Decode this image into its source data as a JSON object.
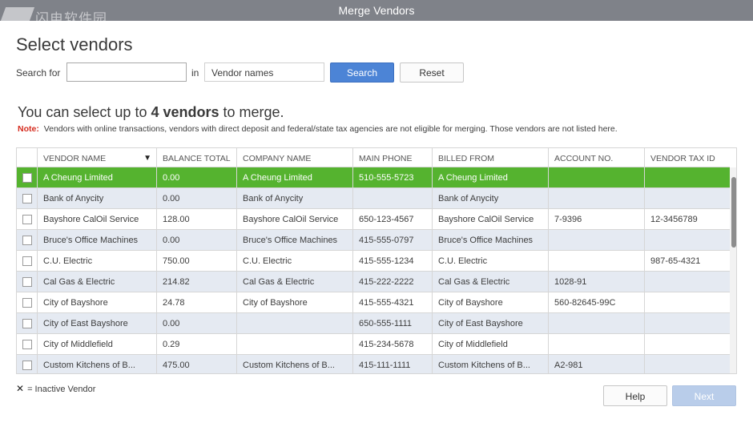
{
  "window": {
    "title": "Merge Vendors",
    "watermark": "闪电软件园"
  },
  "heading": "Select vendors",
  "search": {
    "label": "Search for",
    "value": "",
    "in_label": "in",
    "field_selected": "Vendor names",
    "search_button": "Search",
    "reset_button": "Reset"
  },
  "info": {
    "prefix": "You can select up to ",
    "count": "4 vendors",
    "suffix": " to merge."
  },
  "note": {
    "label": "Note:",
    "text": "Vendors with online transactions, vendors with direct deposit and federal/state tax agencies are not eligible for merging. Those vendors are not listed here."
  },
  "table": {
    "columns": [
      "VENDOR NAME",
      "BALANCE TOTAL",
      "COMPANY NAME",
      "MAIN PHONE",
      "BILLED FROM",
      "ACCOUNT NO.",
      "VENDOR TAX ID"
    ],
    "sort_icon": "sort-desc-icon",
    "rows": [
      [
        "A Cheung Limited",
        "0.00",
        "A Cheung Limited",
        "510-555-5723",
        "A Cheung Limited",
        "",
        ""
      ],
      [
        "Bank of Anycity",
        "0.00",
        "Bank of Anycity",
        "",
        "Bank of Anycity",
        "",
        ""
      ],
      [
        "Bayshore CalOil Service",
        "128.00",
        "Bayshore CalOil Service",
        "650-123-4567",
        "Bayshore CalOil Service",
        "7-9396",
        "12-3456789"
      ],
      [
        "Bruce's Office Machines",
        "0.00",
        "Bruce's Office Machines",
        "415-555-0797",
        "Bruce's Office Machines",
        "",
        ""
      ],
      [
        "C.U. Electric",
        "750.00",
        "C.U. Electric",
        "415-555-1234",
        "C.U. Electric",
        "",
        "987-65-4321"
      ],
      [
        "Cal Gas & Electric",
        "214.82",
        "Cal Gas & Electric",
        "415-222-2222",
        "Cal Gas & Electric",
        "1028-91",
        ""
      ],
      [
        "City of Bayshore",
        "24.78",
        "City of Bayshore",
        "415-555-4321",
        "City of Bayshore",
        "560-82645-99C",
        ""
      ],
      [
        "City of East Bayshore",
        "0.00",
        "",
        "650-555-1111",
        "City of East Bayshore",
        "",
        ""
      ],
      [
        "City of Middlefield",
        "0.29",
        "",
        "415-234-5678",
        "City of Middlefield",
        "",
        ""
      ],
      [
        "Custom Kitchens of B...",
        "475.00",
        "Custom Kitchens of B...",
        "415-111-1111",
        "Custom Kitchens of B...",
        "A2-981",
        ""
      ]
    ]
  },
  "legend": {
    "icon": "x-icon",
    "text": "= Inactive Vendor"
  },
  "buttons": {
    "help": "Help",
    "next": "Next"
  },
  "colors": {
    "selected_row": "#55b32f",
    "alt_row": "#e5eaf2",
    "primary_button": "#4c84d6",
    "note_label": "#d52b1e"
  }
}
